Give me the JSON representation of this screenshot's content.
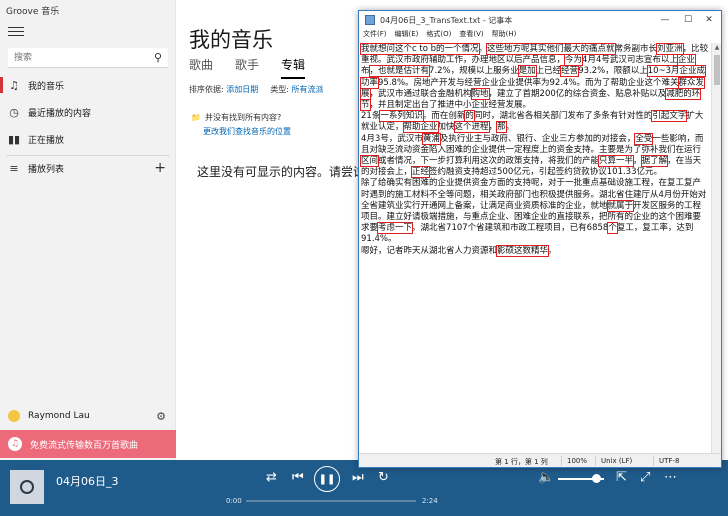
{
  "groove": {
    "app_title": "Groove 音乐",
    "search_placeholder": "搜索",
    "nav": [
      {
        "label": "我的音乐",
        "active": true
      },
      {
        "label": "最近播放的内容",
        "active": false
      },
      {
        "label": "正在播放",
        "active": false
      }
    ],
    "playlists_label": "播放列表",
    "user_name": "Raymond Lau",
    "promo_text": "免费流式传输数百万首歌曲",
    "heading": "我的音乐",
    "tabs": [
      "歌曲",
      "歌手",
      "专辑"
    ],
    "active_tab": "专辑",
    "sort_label": "排序依据:",
    "sort_value": "添加日期",
    "type_label": "类型:",
    "type_value": "所有流派",
    "tip_line1": "并没有找到所有内容?",
    "tip_line2": "更改我们查找音乐的位置",
    "empty_message": "这里没有可显示的内容。请尝试其",
    "now_playing": "04月06日_3",
    "time_current": "0:00",
    "time_total": "2:24",
    "volume_percent": 80
  },
  "notepad": {
    "title": "04月06日_3_TransText.txt - 记事本",
    "menus": [
      "文件(F)",
      "编辑(E)",
      "格式(O)",
      "查看(V)",
      "帮助(H)"
    ],
    "status": {
      "position": "第 1 行，第 1 列",
      "zoom": "100%",
      "eol": "Unix (LF)",
      "encoding": "UTF-8"
    },
    "paragraphs": [
      [
        {
          "t": "我就想问这个c to b的一个情况",
          "m": true
        },
        {
          "t": "。",
          "m": false
        },
        {
          "t": "这些地方呢其实他们最大的痛点就",
          "m": true
        },
        {
          "t": "常务副市长",
          "m": false
        },
        {
          "t": "刘亚洲",
          "m": true
        },
        {
          "t": "，比较重视。武汉市政府辅助工作，办理地区以后产品信息，",
          "m": false
        },
        {
          "t": "今为",
          "m": true
        },
        {
          "t": "4月4号武汉司志宣布以上",
          "m": false
        },
        {
          "t": "企业",
          "m": true
        },
        {
          "t": "布",
          "m": false
        },
        {
          "t": "，也就是估计有",
          "m": true
        },
        {
          "t": "7.2%，规模以上服务业",
          "m": false
        },
        {
          "t": "是加",
          "m": true
        },
        {
          "t": "上已经",
          "m": false
        },
        {
          "t": "经营",
          "m": true
        },
        {
          "t": "93.2%，限额以上",
          "m": false
        },
        {
          "t": "10~3月企业成功率",
          "m": true
        },
        {
          "t": "95.8%。房地产开发与经营企业企业提供率为92.4%。而为了帮助企业这个难关",
          "m": false
        },
        {
          "t": "群众发展",
          "m": true
        },
        {
          "t": "，武汉市通过联合金融机构",
          "m": false
        },
        {
          "t": "购地",
          "m": true
        },
        {
          "t": "，建立了首期200亿的综合资金、贴息补贴以及",
          "m": false
        },
        {
          "t": "减肥的环节",
          "m": true
        },
        {
          "t": "，并且制定出台了推进中小企业经营发展。",
          "m": false
        }
      ],
      [
        {
          "t": "21条",
          "m": false
        },
        {
          "t": "一系列知识",
          "m": true
        },
        {
          "t": "。而在创新",
          "m": false
        },
        {
          "t": "的",
          "m": true
        },
        {
          "t": "同时，湖北省各相关部门发布了多条有针对性的",
          "m": false
        },
        {
          "t": "引起文字",
          "m": true
        },
        {
          "t": "扩大就业认定，",
          "m": false
        },
        {
          "t": "帮助企业",
          "m": true
        },
        {
          "t": "加快",
          "m": false
        },
        {
          "t": "这个进程",
          "m": true
        },
        {
          "t": "，",
          "m": false
        },
        {
          "t": "那",
          "m": true
        },
        {
          "t": "。",
          "m": false
        }
      ],
      [
        {
          "t": "4月3号，武汉市",
          "m": false
        },
        {
          "t": "黄浦",
          "m": true
        },
        {
          "t": "及执行业主与政府、银行、企业三方参加的对接会，",
          "m": false
        },
        {
          "t": "全受",
          "m": true
        },
        {
          "t": "一些影响，而且对缺乏流动资金陷入困难的企业提供一定程度上的资金支持。主要是为了弥补我们在运行",
          "m": false
        },
        {
          "t": "区间",
          "m": true
        },
        {
          "t": "或者情况，下一步打算利用这次的政策支持，将我们的产能",
          "m": false
        },
        {
          "t": "只算一半",
          "m": true
        },
        {
          "t": "，",
          "m": false
        },
        {
          "t": "据了解",
          "m": true
        },
        {
          "t": "，在当天的对接会上，",
          "m": false
        },
        {
          "t": "正经",
          "m": true
        },
        {
          "t": "签约融资支持超过500亿元，引起签约贷款协议101.33亿元。",
          "m": false
        }
      ],
      [
        {
          "t": "除了给确实有困难的企业提供资金方面的支持呢，对于一批重点基础设施工程，在复工复产时遇到的施工材料不全等问题，相关政府部门也积极提供服务。湖北省住建厅从4月份开始对全省建筑业实行开通网上备案，让满足商业资质标准的企业，就地",
          "m": false
        },
        {
          "t": "就属于",
          "m": true
        },
        {
          "t": "开发区服务的工程项目。建立好请极端措施，与重点企业、困难企业的直接联系，把所有的企业的这个困难要求要",
          "m": false
        },
        {
          "t": "考虑一下",
          "m": true
        },
        {
          "t": "。湖北省7107个省建筑和市政工程项目，已有6858",
          "m": false
        },
        {
          "t": "个",
          "m": true
        },
        {
          "t": "复工，复工率，达到91.4%。",
          "m": false
        }
      ],
      [
        {
          "t": "嗯好，记者昨天从湖北省人力资源和",
          "m": false
        },
        {
          "t": "影硕这数精华",
          "m": true
        },
        {
          "t": "。",
          "m": false
        }
      ]
    ]
  }
}
